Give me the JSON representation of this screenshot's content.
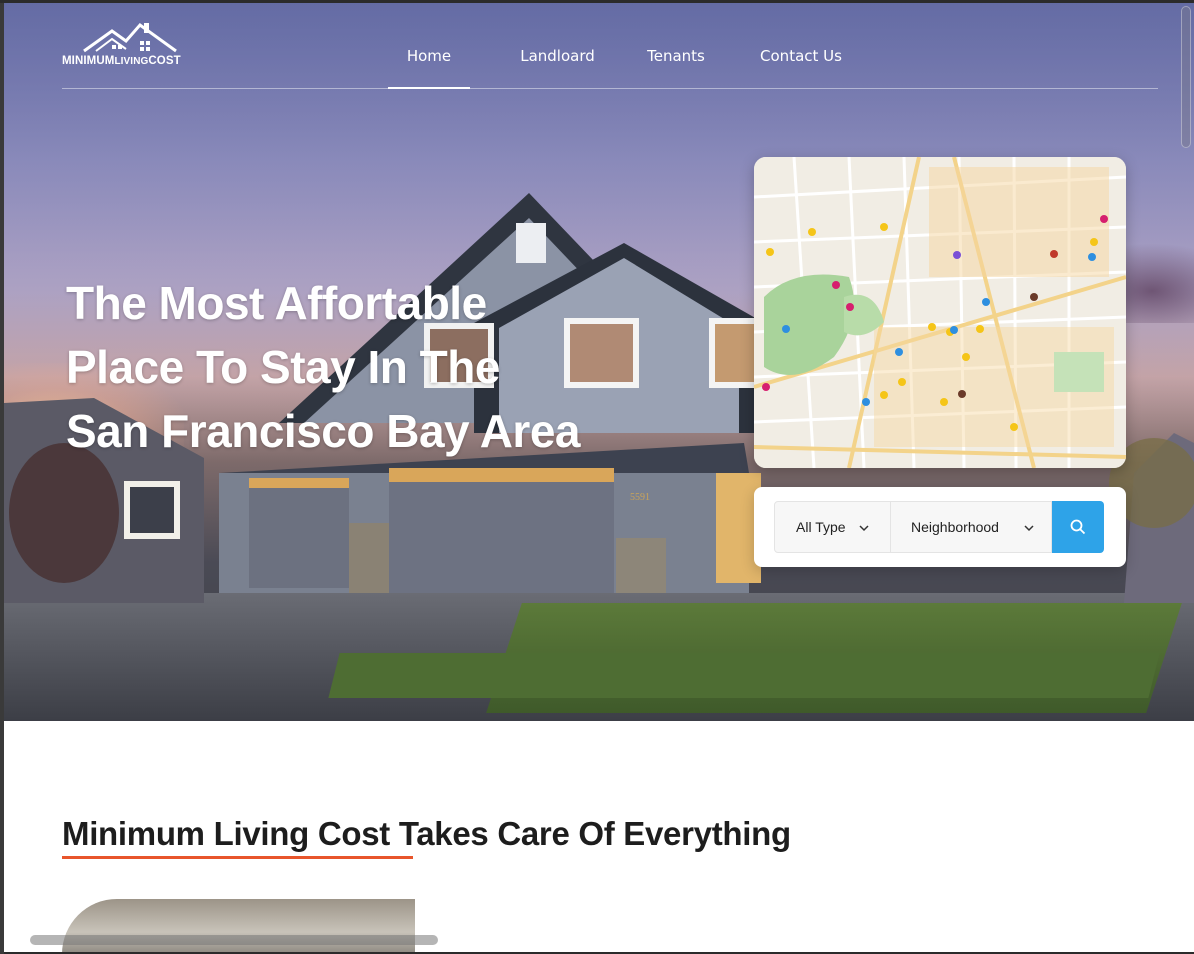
{
  "logo": {
    "text": "MINIMUMLIVINGCOST",
    "parts": [
      "MINIMUM",
      "LIVING",
      "COST"
    ]
  },
  "nav": {
    "items": [
      {
        "label": "Home",
        "active": true
      },
      {
        "label": "Landloard",
        "active": false
      },
      {
        "label": "Tenants",
        "active": false
      },
      {
        "label": "Contact Us",
        "active": false
      }
    ]
  },
  "hero": {
    "headline_lines": [
      "The Most Affortable",
      "Place To Stay In The",
      "San Francisco Bay Area"
    ],
    "house_number": "5591"
  },
  "search": {
    "type_select": "All Type",
    "neighborhood_select": "Neighborhood",
    "search_icon": "search-icon",
    "button_color": "#2ea3e8"
  },
  "section": {
    "title": "Minimum Living Cost Takes Care Of Everything",
    "underline_color": "#e8552b"
  }
}
